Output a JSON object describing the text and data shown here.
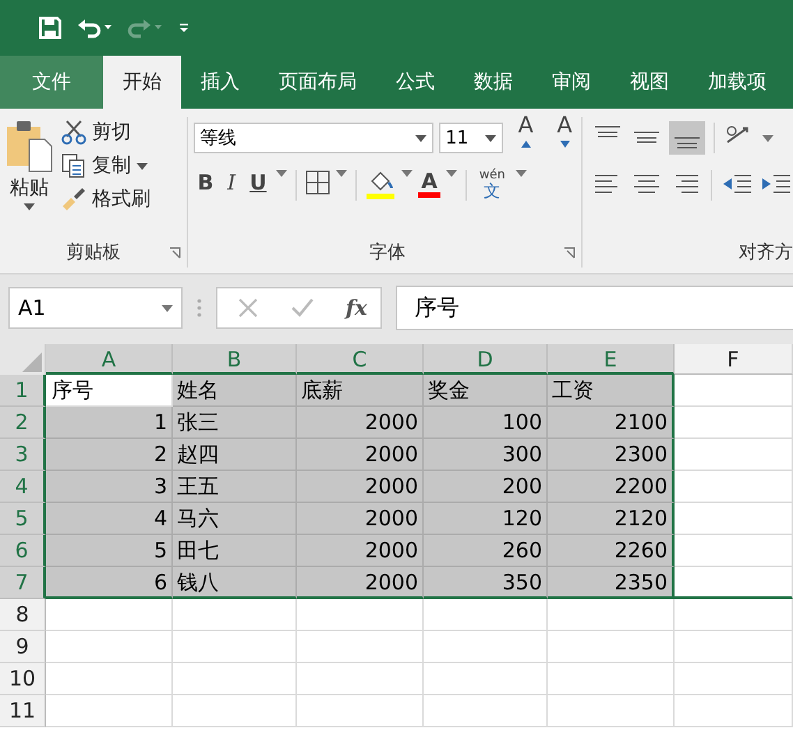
{
  "quick_access": {
    "undo_enabled": true,
    "redo_enabled": false
  },
  "tabs": [
    {
      "label": "文件",
      "kind": "file",
      "selected": false
    },
    {
      "label": "开始",
      "kind": "tab",
      "selected": true
    },
    {
      "label": "插入",
      "kind": "tab",
      "selected": false
    },
    {
      "label": "页面布局",
      "kind": "tab",
      "selected": false
    },
    {
      "label": "公式",
      "kind": "tab",
      "selected": false
    },
    {
      "label": "数据",
      "kind": "tab",
      "selected": false
    },
    {
      "label": "审阅",
      "kind": "tab",
      "selected": false
    },
    {
      "label": "视图",
      "kind": "tab",
      "selected": false
    },
    {
      "label": "加载项",
      "kind": "tab",
      "selected": false
    }
  ],
  "clipboard": {
    "paste": "粘贴",
    "cut": "剪切",
    "copy": "复制",
    "format_painter": "格式刷",
    "label": "剪贴板"
  },
  "font": {
    "name": "等线",
    "size": "11",
    "grow": "A",
    "shrink": "A",
    "bold": "B",
    "italic": "I",
    "underline": "U",
    "font_color": "A",
    "ruby": "wén",
    "ruby_char": "文",
    "label": "字体"
  },
  "alignment": {
    "label": "对齐方",
    "bottom_align_selected": true
  },
  "name_box": "A1",
  "fx": "fx",
  "formula": "序号",
  "columns": [
    {
      "label": "A",
      "selected": true
    },
    {
      "label": "B",
      "selected": true
    },
    {
      "label": "C",
      "selected": true
    },
    {
      "label": "D",
      "selected": true
    },
    {
      "label": "E",
      "selected": true
    },
    {
      "label": "F",
      "selected": false
    }
  ],
  "rows": [
    {
      "label": "1",
      "selected": true,
      "cells": [
        "序号",
        "姓名",
        "底薪",
        "奖金",
        "工资"
      ]
    },
    {
      "label": "2",
      "selected": true,
      "cells": [
        "1",
        "张三",
        "2000",
        "100",
        "2100"
      ]
    },
    {
      "label": "3",
      "selected": true,
      "cells": [
        "2",
        "赵四",
        "2000",
        "300",
        "2300"
      ]
    },
    {
      "label": "4",
      "selected": true,
      "cells": [
        "3",
        "王五",
        "2000",
        "200",
        "2200"
      ]
    },
    {
      "label": "5",
      "selected": true,
      "cells": [
        "4",
        "马六",
        "2000",
        "120",
        "2120"
      ]
    },
    {
      "label": "6",
      "selected": true,
      "cells": [
        "5",
        "田七",
        "2000",
        "260",
        "2260"
      ]
    },
    {
      "label": "7",
      "selected": true,
      "cells": [
        "6",
        "钱八",
        "2000",
        "350",
        "2350"
      ]
    },
    {
      "label": "8",
      "selected": false,
      "cells": []
    },
    {
      "label": "9",
      "selected": false,
      "cells": []
    },
    {
      "label": "10",
      "selected": false,
      "cells": []
    },
    {
      "label": "11",
      "selected": false,
      "cells": []
    }
  ]
}
